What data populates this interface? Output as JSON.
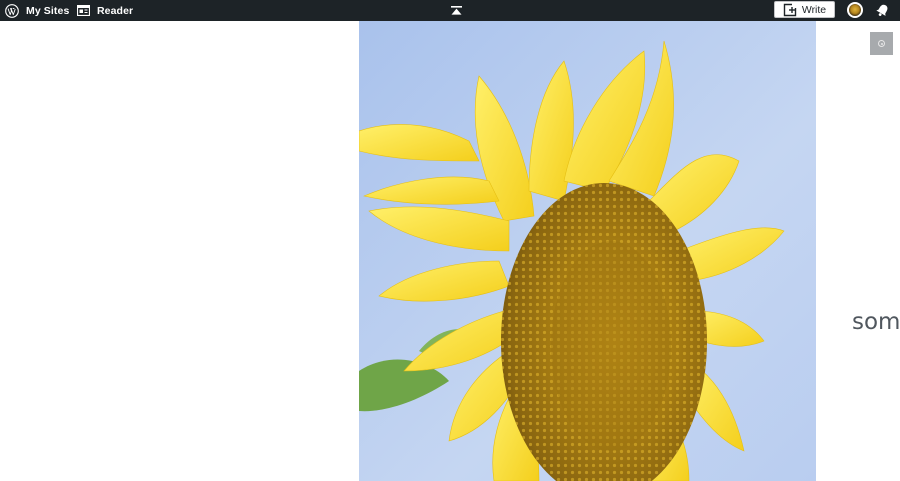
{
  "masterbar": {
    "my_sites_label": "My Sites",
    "reader_label": "Reader",
    "write_label": "Write",
    "icons": {
      "my_sites": "wordpress-logo-icon",
      "reader": "reader-icon",
      "collapse": "collapse-up-icon",
      "write": "write-icon",
      "avatar": "user-avatar",
      "notifications": "bell-icon"
    },
    "colors": {
      "bar": "#1d2327",
      "text": "#ffffff"
    }
  },
  "content": {
    "image_subject": "sunflower",
    "visible_text": "som"
  }
}
